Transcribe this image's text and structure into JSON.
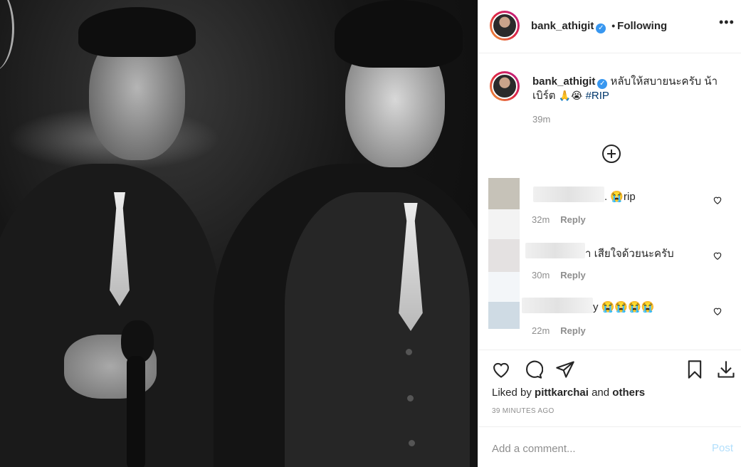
{
  "colors": {
    "verified": "#3897f0",
    "hashtag": "#00376b",
    "post_disabled": "#b2dffc",
    "muted": "#8e8e8e",
    "text": "#262626"
  },
  "photo": {
    "style": "black-and-white",
    "people": 2
  },
  "header": {
    "username": "bank_athigit",
    "verified_icon": "verified-badge-icon",
    "separator": "•",
    "follow_status": "Following",
    "more_icon": "more-options-icon"
  },
  "caption": {
    "username": "bank_athigit",
    "text": "หลับให้สบายนะครับ น้าเบิร์ต",
    "emojis": "🙏😭",
    "hashtag": "#RIP",
    "time": "39m"
  },
  "load_more_icon": "plus-circle-icon",
  "comments": [
    {
      "text_suffix": ". 😭rip",
      "time": "32m",
      "reply": "Reply",
      "avatar_color": "#c6c2b8"
    },
    {
      "text_suffix": "า เสียใจด้วยนะครับ",
      "time": "30m",
      "reply": "Reply",
      "avatar_color": "#e4e1e1"
    },
    {
      "text_suffix": "y 😭😭😭😭",
      "time": "22m",
      "reply": "Reply",
      "avatar_color": "#cfdbe4"
    }
  ],
  "actions": {
    "like_icon": "heart-icon",
    "comment_icon": "comment-icon",
    "share_icon": "share-icon",
    "save_icon": "bookmark-icon",
    "download_icon": "download-icon"
  },
  "likes": {
    "prefix": "Liked by",
    "user": "pittkarchai",
    "connector": "and",
    "others": "others"
  },
  "timestamp": "39 MINUTES AGO",
  "comment_box": {
    "placeholder": "Add a comment...",
    "post_label": "Post"
  }
}
